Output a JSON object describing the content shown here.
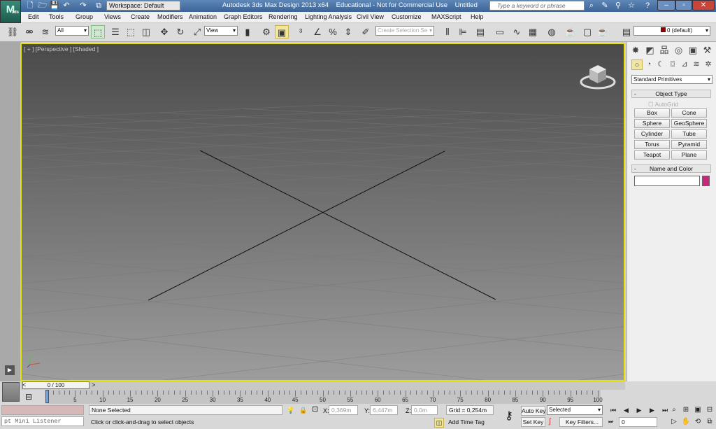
{
  "titlebar": {
    "logo": "3ds",
    "title": "Autodesk 3ds Max Design 2013 x64    Educational - Not for Commercial Use    Untitled",
    "workspace": "Workspace: Default",
    "search_placeholder": "Type a keyword or phrase",
    "quick_access": [
      {
        "name": "new-file-icon",
        "g": "🗋"
      },
      {
        "name": "open-file-icon",
        "g": "🗁"
      },
      {
        "name": "save-icon",
        "g": "💾"
      },
      {
        "name": "undo-icon",
        "g": "↶"
      },
      {
        "name": "redo-icon",
        "g": "↷"
      },
      {
        "name": "project-folder-icon",
        "g": "⧉"
      }
    ],
    "tools": [
      {
        "name": "binoculars-icon",
        "g": "⌕"
      },
      {
        "name": "wrench-icon",
        "g": "✎"
      },
      {
        "name": "satellite-icon",
        "g": "⚲"
      },
      {
        "name": "star-icon",
        "g": "☆"
      },
      {
        "name": "help-icon",
        "g": "?"
      }
    ],
    "window": {
      "minimize": "–",
      "maximize": "▫",
      "close": "✕"
    }
  },
  "menu": [
    "Edit",
    "Tools",
    "Group",
    "Views",
    "Create",
    "Modifiers",
    "Animation",
    "Graph Editors",
    "Rendering",
    "Lighting Analysis",
    "Civil View",
    "Customize",
    "MAXScript",
    "Help"
  ],
  "toolbar": {
    "selection_filter": "All",
    "ref_coord": "View",
    "named_selection_placeholder": "Create Selection Se",
    "layer": "0 (default)",
    "layer_color": "#8b0000",
    "icons": [
      {
        "name": "link-icon",
        "g": "⛓"
      },
      {
        "name": "unlink-icon",
        "g": "⚮"
      },
      {
        "name": "bind-spacewarp-icon",
        "g": "≋"
      },
      {
        "name": "select-object-icon",
        "g": "⬚"
      },
      {
        "name": "select-by-name-icon",
        "g": "☰"
      },
      {
        "name": "rect-selection-icon",
        "g": "⬚"
      },
      {
        "name": "window-crossing-icon",
        "g": "◫"
      },
      {
        "name": "move-icon",
        "g": "✥"
      },
      {
        "name": "rotate-icon",
        "g": "↻"
      },
      {
        "name": "scale-icon",
        "g": "⤢"
      },
      {
        "name": "mirror-pivot-icon",
        "g": "▮"
      },
      {
        "name": "manipulate-icon",
        "g": "⚙"
      },
      {
        "name": "keyboard-shortcut-icon",
        "g": "▣"
      },
      {
        "name": "snap-3d-icon",
        "g": "³"
      },
      {
        "name": "angle-snap-icon",
        "g": "∠"
      },
      {
        "name": "percent-snap-icon",
        "g": "%"
      },
      {
        "name": "spinner-snap-icon",
        "g": "⇕"
      },
      {
        "name": "edit-named-selection-icon",
        "g": "✐"
      },
      {
        "name": "mirror-icon",
        "g": "⫴"
      },
      {
        "name": "align-icon",
        "g": "⊫"
      },
      {
        "name": "layer-manager-icon",
        "g": "▤"
      },
      {
        "name": "scene-explorer-icon",
        "g": "▭"
      },
      {
        "name": "curve-editor-icon",
        "g": "∿"
      },
      {
        "name": "schematic-view-icon",
        "g": "▦"
      },
      {
        "name": "material-editor-icon",
        "g": "◍"
      },
      {
        "name": "render-setup-icon",
        "g": "☕"
      },
      {
        "name": "rendered-frame-icon",
        "g": "▢"
      },
      {
        "name": "render-icon",
        "g": "☕"
      },
      {
        "name": "layer-icon",
        "g": "▤"
      }
    ]
  },
  "viewport": {
    "label": "[ + ] [Perspective ] [Shaded ]",
    "bg_top": "#4a4a4a",
    "bg_bottom": "#9d9d9d",
    "border": "#e8e200"
  },
  "command_panel": {
    "tabs": [
      {
        "name": "create-tab-icon",
        "g": "✸"
      },
      {
        "name": "modify-tab-icon",
        "g": "◩"
      },
      {
        "name": "hierarchy-tab-icon",
        "g": "品"
      },
      {
        "name": "motion-tab-icon",
        "g": "◎"
      },
      {
        "name": "display-tab-icon",
        "g": "▣"
      },
      {
        "name": "utilities-tab-icon",
        "g": "⚒"
      }
    ],
    "subtabs": [
      {
        "name": "geometry-icon",
        "g": "○"
      },
      {
        "name": "shapes-icon",
        "g": "◔"
      },
      {
        "name": "lights-icon",
        "g": "☾"
      },
      {
        "name": "cameras-icon",
        "g": "⌼"
      },
      {
        "name": "helpers-icon",
        "g": "⊿"
      },
      {
        "name": "spacewarps-icon",
        "g": "≋"
      },
      {
        "name": "systems-icon",
        "g": "✲"
      }
    ],
    "category": "Standard Primitives",
    "object_type": "Object Type",
    "autogrid": "AutoGrid",
    "buttons": [
      "Box",
      "Cone",
      "Sphere",
      "GeoSphere",
      "Cylinder",
      "Tube",
      "Torus",
      "Pyramid",
      "Teapot",
      "Plane"
    ],
    "name_and_color": "Name and Color",
    "name_value": "",
    "object_color": "#c8287a",
    "collapse": "-"
  },
  "timeline": {
    "frame": "0 / 100",
    "prev": "<",
    "next": ">",
    "ticks": [
      0,
      5,
      10,
      15,
      20,
      25,
      30,
      35,
      40,
      45,
      50,
      55,
      60,
      65,
      70,
      75,
      80,
      85,
      90,
      95,
      100
    ]
  },
  "status": {
    "listener": "pt Mini Listener",
    "selection": "None Selected",
    "prompt": "Click or click-and-drag to select objects",
    "x_label": "X:",
    "x": "0,369m",
    "y_label": "Y:",
    "y": "6,447m",
    "z_label": "Z:",
    "z": "0,0m",
    "grid": "Grid = 0,254m",
    "add_time_tag": "Add Time Tag",
    "auto_key": "Auto Key",
    "set_key": "Set Key",
    "key_mode": "Selected",
    "key_filters": "Key Filters...",
    "current_frame": "0"
  },
  "anim_controls": [
    {
      "name": "goto-start-icon",
      "g": "⏮"
    },
    {
      "name": "prev-frame-icon",
      "g": "◀"
    },
    {
      "name": "play-icon",
      "g": "▶"
    },
    {
      "name": "next-frame-icon",
      "g": "▶"
    },
    {
      "name": "goto-end-icon",
      "g": "⏭"
    }
  ],
  "nav_controls": [
    {
      "name": "zoom-icon",
      "g": "⌕"
    },
    {
      "name": "zoom-all-icon",
      "g": "⊞"
    },
    {
      "name": "zoom-extents-icon",
      "g": "▣"
    },
    {
      "name": "zoom-extents-all-icon",
      "g": "⊟"
    },
    {
      "name": "field-of-view-icon",
      "g": "▷"
    },
    {
      "name": "pan-icon",
      "g": "✋"
    },
    {
      "name": "orbit-icon",
      "g": "⟲"
    },
    {
      "name": "maximize-viewport-icon",
      "g": "⧉"
    }
  ]
}
